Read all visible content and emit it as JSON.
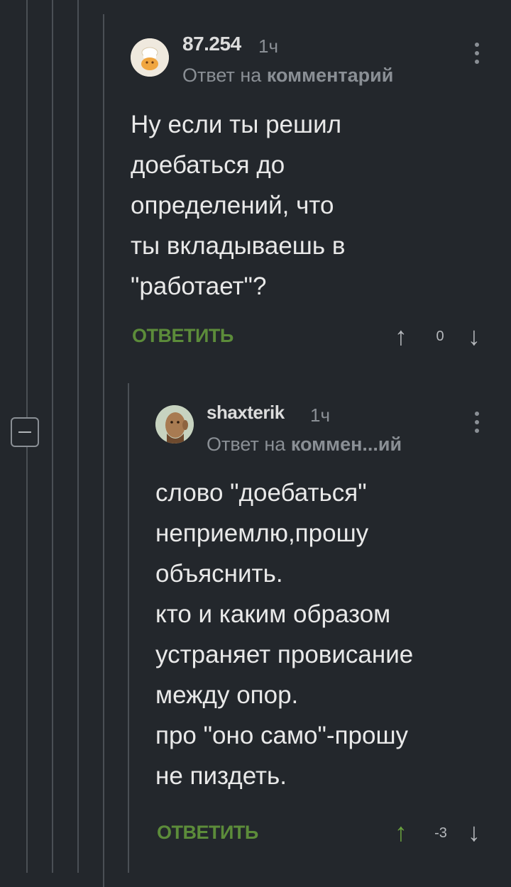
{
  "comments": [
    {
      "username": "87.254",
      "time": "1ч",
      "reply_prefix": "Ответ на ",
      "reply_target": "комментарий",
      "text": "Ну если ты решил\nдоебаться до\nопределений, что\nты вкладываешь в\n\"работает\"?",
      "reply_label": "ОТВЕТИТЬ",
      "score": "0",
      "up_arrow": "↑",
      "down_arrow": "↓"
    },
    {
      "username": "shaxterik",
      "time": "1ч",
      "reply_prefix": "Ответ на ",
      "reply_target": "коммен...ий",
      "text": "слово \"доебаться\"\nнеприемлю,прошу\nобъяснить.\nкто и каким образом\nустраняет провисание\nмежду опор.\nпро \"оно само\"-прошу\nне пиздеть.",
      "reply_label": "ОТВЕТИТЬ",
      "score": "-3",
      "up_arrow": "↑",
      "down_arrow": "↓"
    }
  ],
  "colors": {
    "background": "#23272c",
    "thread_line": "#4a4f55",
    "reply_green": "#5c8c3a",
    "upvoted_green": "#6aa23e",
    "muted": "#8a8f95"
  }
}
